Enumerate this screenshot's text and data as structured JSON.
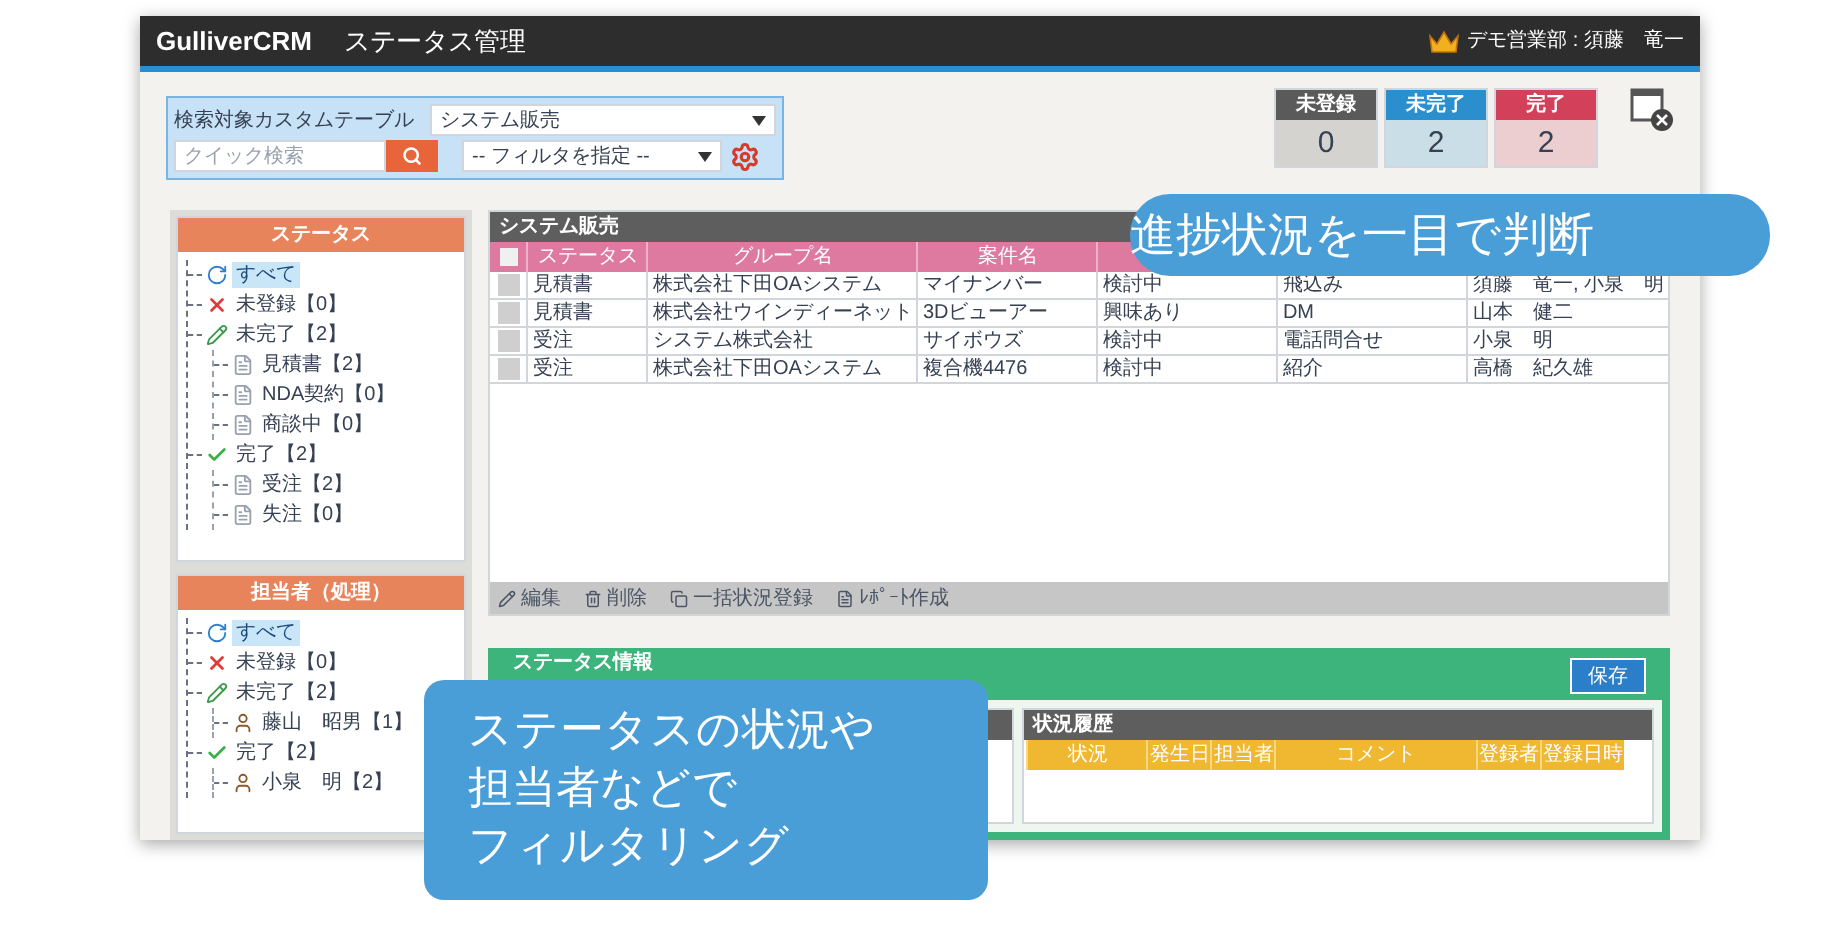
{
  "header": {
    "app_name": "GulliverCRM",
    "title": "ステータス管理",
    "user": "デモ営業部 : 須藤　竜一"
  },
  "search": {
    "label": "検索対象カスタムテーブル",
    "table_select": "システム販売",
    "quick_search": {
      "placeholder": "クイック検索"
    },
    "filter_select": "-- フィルタを指定 --"
  },
  "counters": [
    {
      "label": "未登録",
      "value": "0",
      "color": "#5a5a5a"
    },
    {
      "label": "未完了",
      "value": "2",
      "color": "#2a8fcc"
    },
    {
      "label": "完了",
      "value": "2",
      "color": "#d2405a"
    }
  ],
  "status_tree": {
    "title": "ステータス",
    "items": [
      {
        "label": "すべて",
        "kind": "all",
        "selected": true
      },
      {
        "label": "未登録【0】",
        "kind": "unregistered",
        "selected": false
      },
      {
        "label": "未完了【2】",
        "kind": "incomplete",
        "selected": false,
        "children": [
          {
            "label": "見積書【2】",
            "kind": "document",
            "selected": false
          },
          {
            "label": "NDA契約【0】",
            "kind": "document",
            "selected": false
          },
          {
            "label": "商談中【0】",
            "kind": "document",
            "selected": false
          }
        ]
      },
      {
        "label": "完了【2】",
        "kind": "complete",
        "selected": false,
        "children": [
          {
            "label": "受注【2】",
            "kind": "document",
            "selected": false
          },
          {
            "label": "失注【0】",
            "kind": "document",
            "selected": false
          }
        ]
      }
    ]
  },
  "assignee_tree": {
    "title": "担当者（処理）",
    "items": [
      {
        "label": "すべて",
        "kind": "all",
        "selected": true
      },
      {
        "label": "未登録【0】",
        "kind": "unregistered",
        "selected": false
      },
      {
        "label": "未完了【2】",
        "kind": "incomplete",
        "selected": false,
        "children": [
          {
            "label": "藤山　昭男【1】",
            "kind": "person",
            "selected": false
          }
        ]
      },
      {
        "label": "完了【2】",
        "kind": "complete",
        "selected": false,
        "children": [
          {
            "label": "小泉　明【2】",
            "kind": "person",
            "selected": false
          }
        ]
      }
    ]
  },
  "table": {
    "title": "システム販売",
    "select_all_checked": false,
    "columns": [
      "ステータス",
      "グループ名",
      "案件名"
    ],
    "rows": [
      {
        "checked": false,
        "cells": [
          "見積書",
          "株式会社下田OAシステム",
          "マイナンバー",
          "検討中",
          "飛込み",
          "須藤　竜一, 小泉　明"
        ]
      },
      {
        "checked": false,
        "cells": [
          "見積書",
          "株式会社ウインディーネット",
          "3Dビューアー",
          "興味あり",
          "DM",
          "山本　健二"
        ]
      },
      {
        "checked": false,
        "cells": [
          "受注",
          "システム株式会社",
          "サイボウズ",
          "検討中",
          "電話問合せ",
          "小泉　明"
        ]
      },
      {
        "checked": false,
        "cells": [
          "受注",
          "株式会社下田OAシステム",
          "複合機4476",
          "検討中",
          "紹介",
          "高橋　紀久雄"
        ]
      }
    ],
    "toolbar": [
      "編集",
      "削除",
      "一括状況登録",
      "ﾚﾎﾟｰﾄ作成"
    ]
  },
  "status_info": {
    "title": "ステータス情報",
    "save_button": "保存",
    "history": {
      "title": "状況履歴",
      "columns": [
        "状況",
        "発生日",
        "担当者",
        "コメント",
        "登録者",
        "登録日時"
      ]
    }
  },
  "callouts": [
    {
      "lines": [
        "進捗状況を一目で判断"
      ]
    },
    {
      "lines": [
        "ステータスの状況や",
        "担当者などで",
        "フィルタリング"
      ]
    }
  ]
}
